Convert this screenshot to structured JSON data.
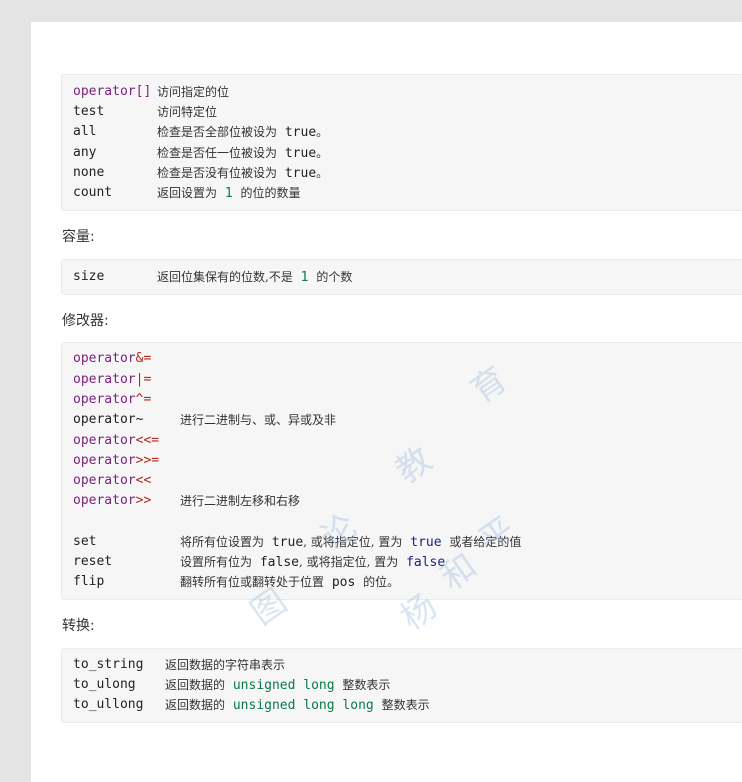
{
  "access": {
    "rows": [
      {
        "name": "operator[]",
        "desc": "访问指定的位"
      },
      {
        "name": "test",
        "desc": "访问特定位"
      },
      {
        "name": "all",
        "desc": "检查是否全部位被设为",
        "lit": "true",
        "tail": "。"
      },
      {
        "name": "any",
        "desc": "检查是否任一位被设为",
        "lit": "true",
        "tail": "。"
      },
      {
        "name": "none",
        "desc": "检查是否没有位被设为",
        "lit": "true",
        "tail": "。"
      },
      {
        "name": "count",
        "desc": "返回设置为",
        "num": "1",
        "tail": "的位的数量"
      }
    ]
  },
  "capacity": {
    "heading": "容量:",
    "name": "size",
    "desc": "返回位集保有的位数,不是",
    "num": "1",
    "tail": "的个数"
  },
  "modifiers": {
    "heading": "修改器:",
    "ops": [
      {
        "kw": "operator",
        "op": "&="
      },
      {
        "kw": "operator",
        "op": "|="
      },
      {
        "kw": "operator",
        "op": "^="
      },
      {
        "kw": "operator",
        "op": "~",
        "desc": "进行二进制与、或、异或及非"
      },
      {
        "kw": "operator",
        "op": "<<="
      },
      {
        "kw": "operator",
        "op": ">>="
      },
      {
        "kw": "operator",
        "op": "<<"
      },
      {
        "kw": "operator",
        "op": ">>",
        "desc": "进行二进制左移和右移"
      }
    ],
    "set": {
      "name": "set",
      "a": "将所有位设置为",
      "lit1": "true",
      "b": ", 或将指定位, 置为",
      "lit2": "true",
      "c": "或者给定的值"
    },
    "reset": {
      "name": "reset",
      "a": "设置所有位为",
      "lit1": "false",
      "b": ", 或将指定位, 置为",
      "lit2": "false"
    },
    "flip": {
      "name": "flip",
      "a": "翻转所有位或翻转处于位置",
      "lit1": "pos",
      "b": "的位。"
    }
  },
  "conversions": {
    "heading": "转换:",
    "rows": [
      {
        "name": "to_string",
        "desc": "返回数据的字符串表示"
      },
      {
        "name": "to_ulong",
        "desc": "返回数据的",
        "type": "unsigned long",
        "tail": "整数表示"
      },
      {
        "name": "to_ullong",
        "desc": "返回数据的",
        "type": "unsigned long long",
        "tail": "整数表示"
      }
    ]
  },
  "watermark": {
    "chars": [
      "育",
      "教",
      "图",
      "论",
      "杨",
      "和",
      "平"
    ]
  }
}
